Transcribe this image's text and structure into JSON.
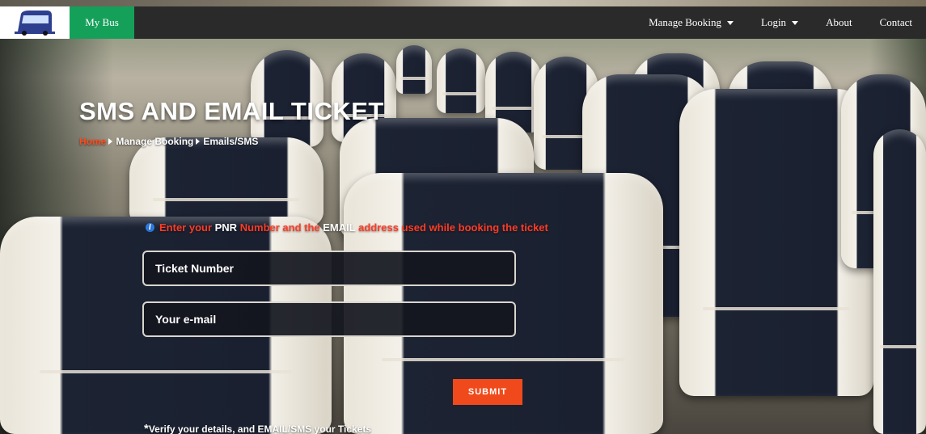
{
  "navbar": {
    "logo_icon": "bus-logo-icon",
    "brand": "My Bus",
    "items": [
      {
        "label": "Manage Booking",
        "dropdown": true
      },
      {
        "label": "Login",
        "dropdown": true
      },
      {
        "label": "About",
        "dropdown": false
      },
      {
        "label": "Contact",
        "dropdown": false
      }
    ]
  },
  "hero": {
    "title": "SMS AND EMAIL TICKET",
    "breadcrumb": {
      "home": "Home",
      "items": [
        "Manage Booking",
        "Emails/SMS"
      ]
    }
  },
  "form": {
    "info": {
      "icon": "info-icon",
      "parts": [
        {
          "text": "Enter your ",
          "color": "red"
        },
        {
          "text": "PNR",
          "color": "white"
        },
        {
          "text": " Number and the ",
          "color": "red"
        },
        {
          "text": "EMAIL",
          "color": "white"
        },
        {
          "text": " address used while booking the ticket",
          "color": "red"
        }
      ]
    },
    "ticket_placeholder": "Ticket Number",
    "email_placeholder": "Your e-mail",
    "submit_label": "SUBMIT",
    "note_star": "*",
    "note": "Verify your details, and EMAIL/SMS your Tickets"
  },
  "colors": {
    "navbar_bg": "#2a2a2a",
    "brand_bg": "#15a05a",
    "accent": "#f04a1c",
    "breadcrumb_home": "#ff4a1c"
  }
}
